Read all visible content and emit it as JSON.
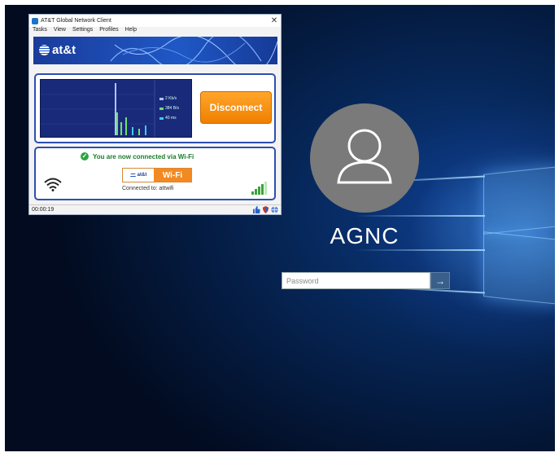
{
  "login": {
    "username": "AGNC",
    "password_placeholder": "Password",
    "submit_glyph": "→"
  },
  "client": {
    "title": "AT&T Global Network Client",
    "close_glyph": "✕",
    "menu": [
      "Tasks",
      "View",
      "Settings",
      "Profiles",
      "Help"
    ],
    "brand": "at&t",
    "graph_legend": [
      {
        "label": "2 Kb/s",
        "color": "#b0c4ff"
      },
      {
        "label": "384 B/s",
        "color": "#6fe06f"
      },
      {
        "label": "40 ms",
        "color": "#3fc7ff"
      }
    ],
    "disconnect_label": "Disconnect",
    "status_message": "You are now connected via Wi-Fi",
    "badge_brand": "at&t",
    "badge_wifi": "Wi-Fi",
    "connected_to": "Connected to: attwifi",
    "timer": "00:00:19",
    "signal_level": 0.8,
    "status_icons": [
      "thumbs-up-icon",
      "shield-icon",
      "globe-icon"
    ]
  },
  "colors": {
    "brand_blue": "#1f58c6",
    "disconnect_orange": "#f08000",
    "connected_green": "#1a7a2a"
  }
}
